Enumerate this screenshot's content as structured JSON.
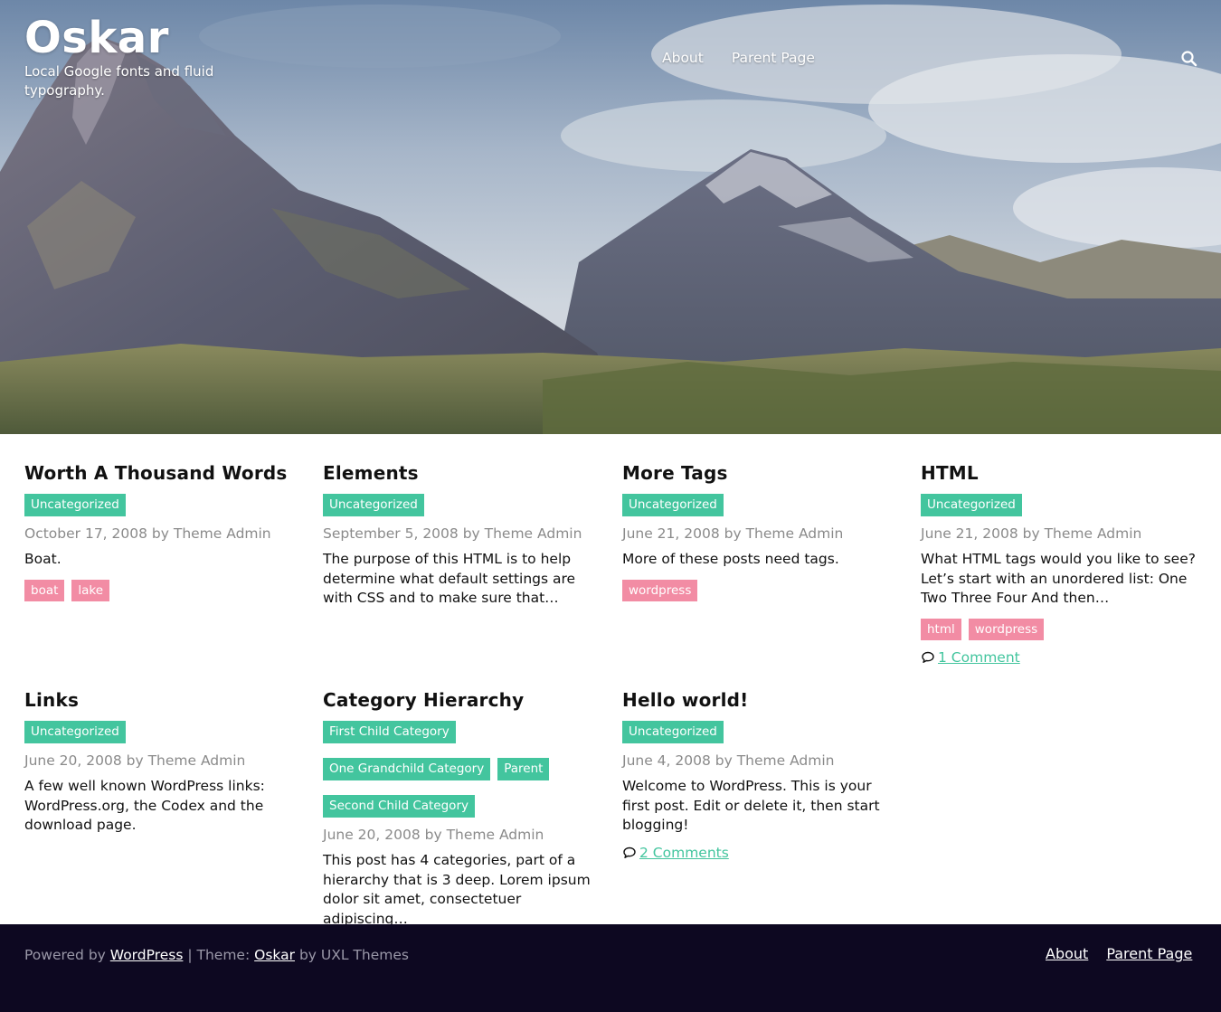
{
  "header": {
    "site_title": "Oskar",
    "tagline": "Local Google fonts and fluid typography.",
    "nav": [
      "About",
      "Parent Page"
    ]
  },
  "posts": [
    {
      "title": "Worth A Thousand Words",
      "categories": [
        "Uncategorized"
      ],
      "meta": "October 17, 2008 by Theme Admin",
      "excerpt": "Boat.",
      "tags": [
        "boat",
        "lake"
      ]
    },
    {
      "title": "Elements",
      "categories": [
        "Uncategorized"
      ],
      "meta": "September 5, 2008 by Theme Admin",
      "excerpt": "The purpose of this HTML is to help determine what default settings are with CSS and to make sure that…"
    },
    {
      "title": "More Tags",
      "categories": [
        "Uncategorized"
      ],
      "meta": "June 21, 2008 by Theme Admin",
      "excerpt": "More of these posts need tags.",
      "tags": [
        "wordpress"
      ]
    },
    {
      "title": "HTML",
      "categories": [
        "Uncategorized"
      ],
      "meta": "June 21, 2008 by Theme Admin",
      "excerpt": "What HTML tags would you like to see? Let’s start with an unordered list: One Two Three Four And then…",
      "tags": [
        "html",
        "wordpress"
      ],
      "comments": "1 Comment"
    },
    {
      "title": "Links",
      "categories": [
        "Uncategorized"
      ],
      "meta": "June 20, 2008 by Theme Admin",
      "excerpt": "A few well known WordPress links: WordPress.org, the Codex and the download page."
    },
    {
      "title": "Category Hierarchy",
      "categories": [
        "First Child Category",
        "One Grandchild Category",
        "Parent",
        "Second Child Category"
      ],
      "meta": "June 20, 2008 by Theme Admin",
      "excerpt": "This post has 4 categories, part of a hierarchy that is 3 deep. Lorem ipsum dolor sit amet, consectetuer adipiscing…"
    },
    {
      "title": "Hello world!",
      "categories": [
        "Uncategorized"
      ],
      "meta": "June 4, 2008 by Theme Admin",
      "excerpt": "Welcome to WordPress. This is your first post. Edit or delete it, then start blogging!",
      "comments": "2 Comments"
    }
  ],
  "footer": {
    "powered_by": "Powered by",
    "wordpress_link": "WordPress",
    "separator": "| Theme:",
    "theme_link": "Oskar",
    "by": "by UXL Themes",
    "nav": [
      "About",
      "Parent Page"
    ]
  },
  "colors": {
    "category_badge": "#43c59e",
    "tag_badge": "#f28ca4",
    "footer_bg": "#0d0821",
    "link": "#43c59e"
  },
  "icons": {
    "search": "search-icon",
    "comment": "comment-icon"
  }
}
